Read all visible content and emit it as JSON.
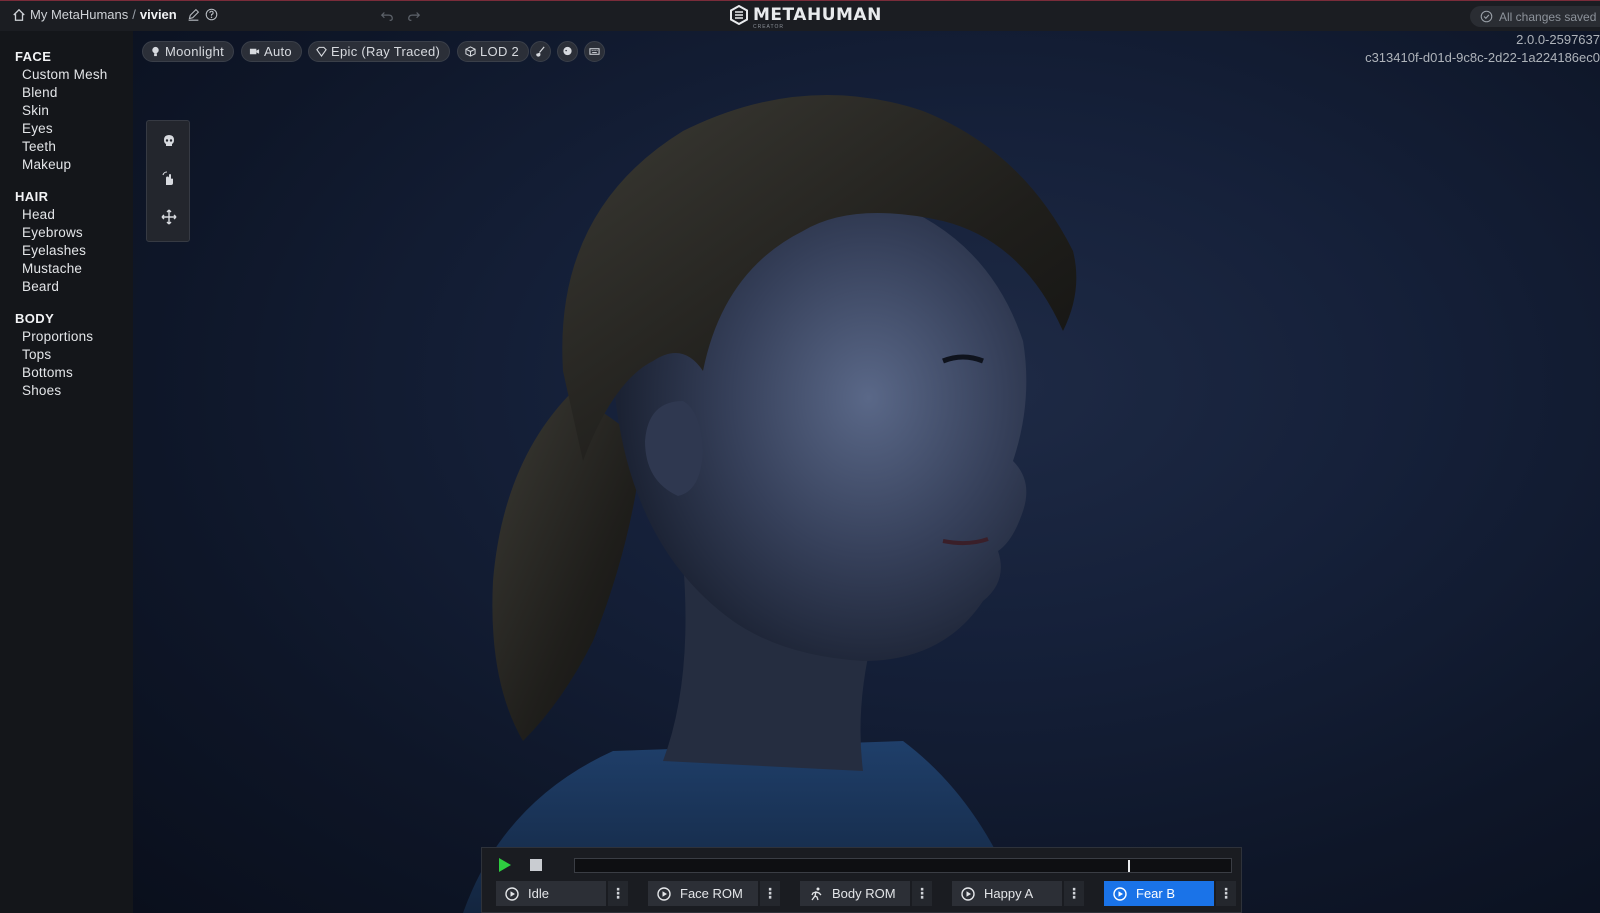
{
  "topbar": {
    "breadcrumb_root": "My MetaHumans",
    "breadcrumb_sep": "/",
    "project_name": "vivien",
    "brand": "METAHUMAN",
    "brand_sub": "CREATOR",
    "save_status": "All changes saved"
  },
  "sidebar": {
    "face_title": "FACE",
    "face_items": [
      "Custom Mesh",
      "Blend",
      "Skin",
      "Eyes",
      "Teeth",
      "Makeup"
    ],
    "hair_title": "HAIR",
    "hair_items": [
      "Head",
      "Eyebrows",
      "Eyelashes",
      "Mustache",
      "Beard"
    ],
    "body_title": "BODY",
    "body_items": [
      "Proportions",
      "Tops",
      "Bottoms",
      "Shoes"
    ]
  },
  "viewport": {
    "lighting": "Moonlight",
    "camera": "Auto",
    "quality": "Epic (Ray Traced)",
    "lod": "LOD 2",
    "version": "2.0.0-2597637",
    "build_id": "c313410f-d01d-9c8c-2d22-1a224186ec0"
  },
  "player": {
    "progress": 0.846,
    "animations": [
      {
        "label": "Idle",
        "icon": "play-circle-icon"
      },
      {
        "label": "Face ROM",
        "icon": "play-circle-icon"
      },
      {
        "label": "Body ROM",
        "icon": "running-person-icon"
      },
      {
        "label": "Happy A",
        "icon": "play-circle-icon"
      },
      {
        "label": "Fear B",
        "icon": "play-circle-icon",
        "active": true
      }
    ]
  },
  "colors": {
    "accent": "#1a73e8",
    "play_green": "#2ecc40",
    "titlebar_border": "#7a2c3a"
  }
}
